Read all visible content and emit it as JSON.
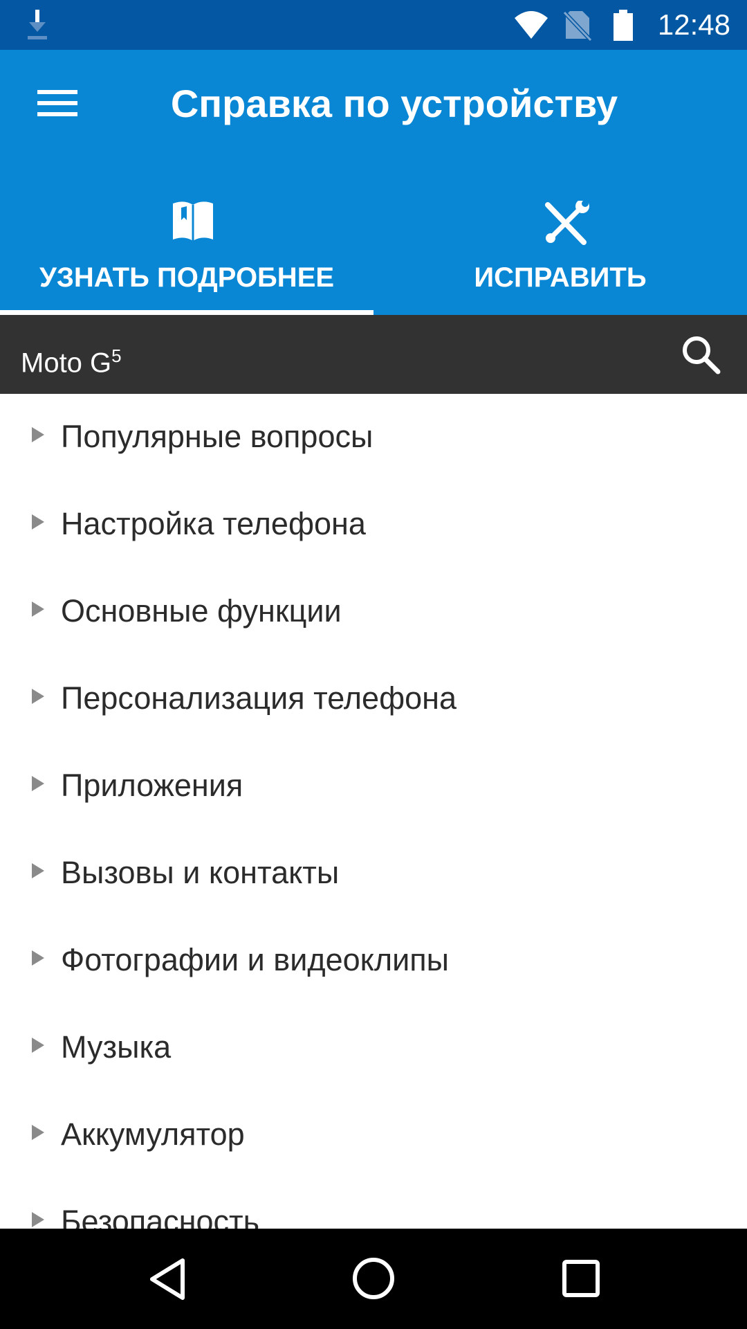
{
  "status_bar": {
    "time": "12:48",
    "icons": [
      "download-icon",
      "wifi-icon",
      "no-sim-icon",
      "battery-icon"
    ]
  },
  "app_bar": {
    "title": "Справка по устройству",
    "menu_icon": "menu-icon",
    "tabs": [
      {
        "label": "УЗНАТЬ ПОДРОБНЕЕ",
        "icon": "book-icon",
        "selected": true
      },
      {
        "label": "ИСПРАВИТЬ",
        "icon": "tools-icon",
        "selected": false
      }
    ]
  },
  "device_bar": {
    "device_name": "Moto G",
    "device_superscript": "5",
    "search_icon": "search-icon"
  },
  "topics": [
    "Популярные вопросы",
    "Настройка телефона",
    "Основные функции",
    "Персонализация телефона",
    "Приложения",
    "Вызовы и контакты",
    "Фотографии и видеоклипы",
    "Музыка",
    "Аккумулятор",
    "Безопасность"
  ],
  "nav_bar": {
    "icons": [
      "back-icon",
      "home-icon",
      "recents-icon"
    ]
  },
  "colors": {
    "status_bar": "#0458a3",
    "app_bar": "#0a87d4",
    "device_bar": "#323232",
    "nav_bar": "#000000",
    "list_text": "#2b2b2b",
    "arrow": "#8a8a8a"
  }
}
